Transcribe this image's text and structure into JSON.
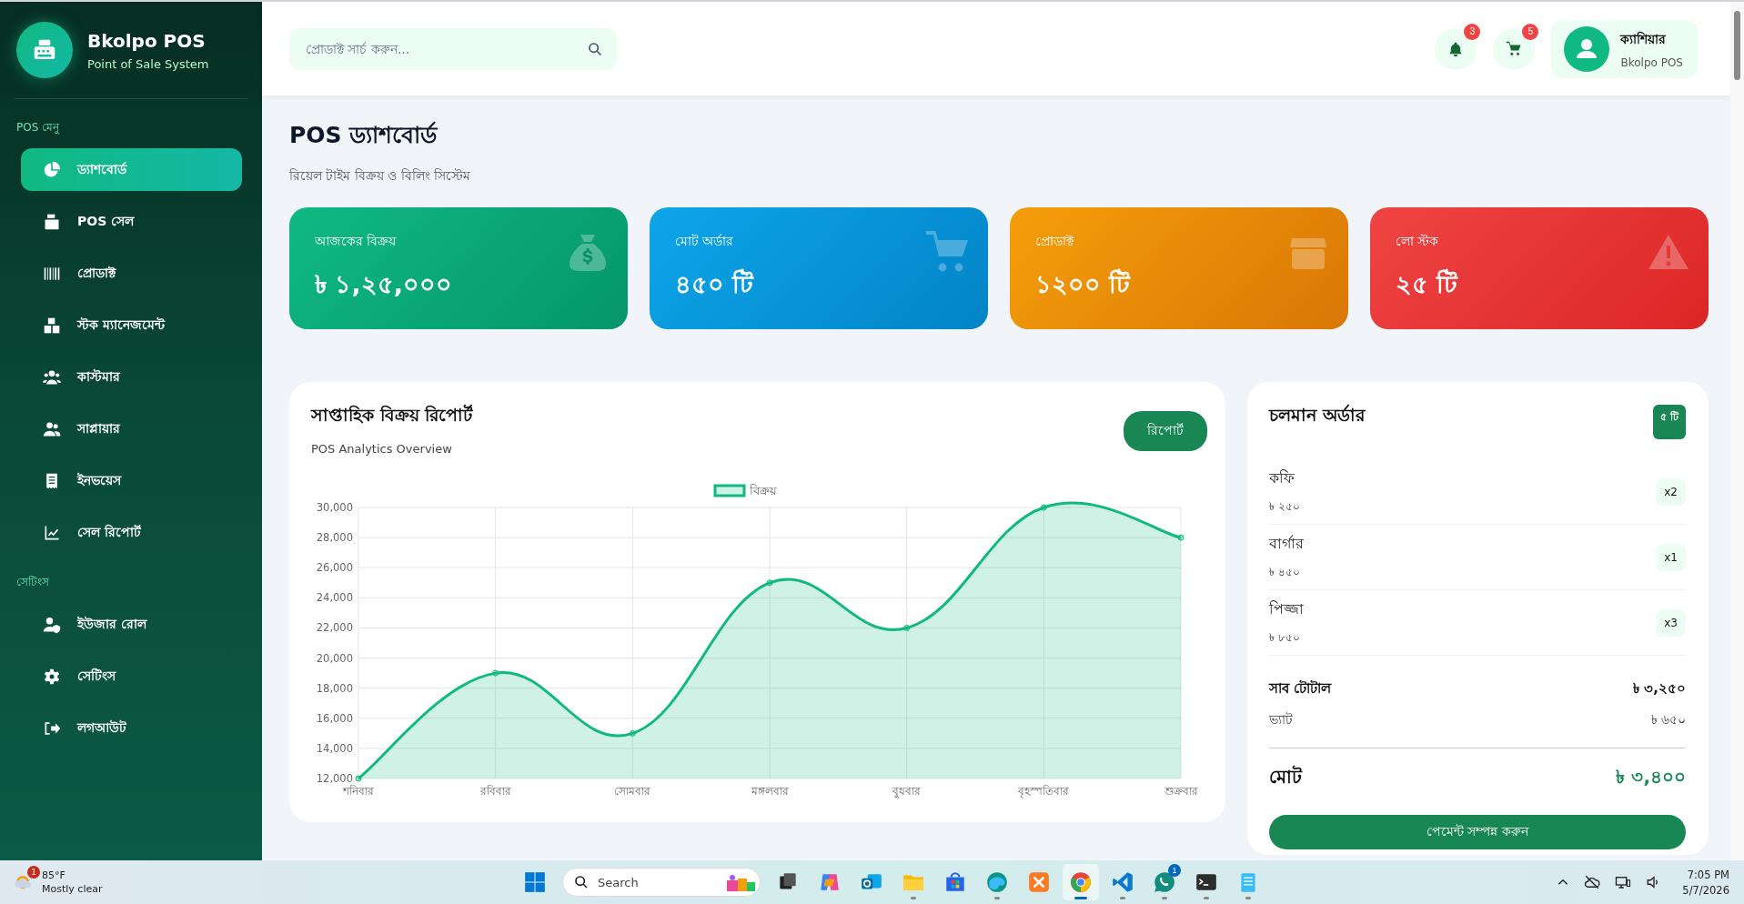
{
  "sidebar": {
    "brand": {
      "title": "Bkolpo POS",
      "subtitle": "Point of Sale System"
    },
    "sections": [
      {
        "heading": "POS মেনু",
        "items": [
          {
            "kind": "chart-pie",
            "label": "ড্যাশবোর্ড",
            "selected": true
          },
          {
            "kind": "register",
            "label": "POS সেল",
            "selected": false
          },
          {
            "kind": "barcode",
            "label": "প্রোডাক্ট",
            "selected": false
          },
          {
            "kind": "boxes",
            "label": "স্টক ম্যানেজমেন্ট",
            "selected": false
          },
          {
            "kind": "users",
            "label": "কাস্টমার",
            "selected": false
          },
          {
            "kind": "user-pair",
            "label": "সাপ্লায়ার",
            "selected": false
          },
          {
            "kind": "receipt",
            "label": "ইনভয়েস",
            "selected": false
          },
          {
            "kind": "line-chart",
            "label": "সেল রিপোর্ট",
            "selected": false
          }
        ]
      },
      {
        "heading": "সেটিংস",
        "items": [
          {
            "kind": "user-shield",
            "label": "ইউজার রোল",
            "selected": false
          },
          {
            "kind": "gear",
            "label": "সেটিংস",
            "selected": false
          },
          {
            "kind": "logout",
            "label": "লগআউট",
            "selected": false
          }
        ]
      }
    ]
  },
  "header": {
    "search": {
      "placeholder": "প্রোডাক্ট সার্চ করুন..."
    },
    "notifications": "3",
    "cart": "5",
    "user": {
      "name": "ক্যাশিয়ার",
      "role": "Bkolpo POS"
    }
  },
  "page": {
    "title": "POS ড্যাশবোর্ড",
    "subtitle": "রিয়েল টাইম বিক্রয় ও বিলিং সিস্টেম"
  },
  "stats": [
    {
      "kind": "sales",
      "label": "আজকের বিক্রয়",
      "value": "৳ ১,২৫,০০০"
    },
    {
      "kind": "orders",
      "label": "মোট অর্ডার",
      "value": "৪৫০ টি"
    },
    {
      "kind": "products",
      "label": "প্রোডাক্ট",
      "value": "১২০০ টি"
    },
    {
      "kind": "low-stock",
      "label": "লো স্টক",
      "value": "২৫ টি"
    }
  ],
  "report": {
    "title": "সাপ্তাহিক বিক্রয় রিপোর্ট",
    "subtitle": "POS Analytics Overview",
    "button": "রিপোর্ট",
    "chart_data": {
      "type": "area",
      "categories": [
        "শনিবার",
        "রবিবার",
        "সোমবার",
        "মঙ্গলবার",
        "বুধবার",
        "বৃহস্পতিবার",
        "শুক্রবার"
      ],
      "series": [
        {
          "name": "বিক্রয়",
          "color": "#10b981",
          "values": [
            12000,
            19000,
            15000,
            25000,
            22000,
            30000,
            28000
          ]
        }
      ],
      "ylim": [
        12000,
        30000
      ],
      "grid": true,
      "yticks": [
        {
          "value": 12000,
          "label": "12,000"
        },
        {
          "value": 14000,
          "label": "14,000"
        },
        {
          "value": 16000,
          "label": "16,000"
        },
        {
          "value": 18000,
          "label": "18,000"
        },
        {
          "value": 20000,
          "label": "20,000"
        },
        {
          "value": 22000,
          "label": "22,000"
        },
        {
          "value": 24000,
          "label": "24,000"
        },
        {
          "value": 26000,
          "label": "26,000"
        },
        {
          "value": 28000,
          "label": "28,000"
        },
        {
          "value": 30000,
          "label": "30,000"
        }
      ]
    }
  },
  "orders": {
    "title": "চলমান অর্ডার",
    "count": "৫ টি",
    "items": [
      {
        "name": "কফি",
        "price": "৳ ২৫০",
        "qty": "x2"
      },
      {
        "name": "বার্গার",
        "price": "৳ ৪৫০",
        "qty": "x1"
      },
      {
        "name": "পিজ্জা",
        "price": "৳ ৮৫০",
        "qty": "x3"
      }
    ],
    "subtotal": {
      "label": "সাব টোটাল",
      "value": "৳ ৩,২৫০"
    },
    "vat": {
      "label": "ভ্যাট",
      "value": "৳ ৬৫০"
    },
    "total": {
      "label": "মোট",
      "value": "৳ ৩,৪০০"
    },
    "pay_button": "পেমেন্ট সম্পন্ন করুন"
  },
  "taskbar": {
    "weather": {
      "temp": "85°F",
      "condition": "Mostly clear",
      "badge": "1"
    },
    "search": "Search",
    "apps": [
      {
        "kind": "start",
        "open": false,
        "selected": false
      },
      {
        "kind": "task-view",
        "open": false,
        "selected": false
      },
      {
        "kind": "copilot",
        "open": false,
        "selected": false
      },
      {
        "kind": "mail",
        "open": false,
        "selected": false
      },
      {
        "kind": "folder",
        "open": true,
        "selected": false
      },
      {
        "kind": "store",
        "open": false,
        "selected": false
      },
      {
        "kind": "edge",
        "open": true,
        "selected": false
      },
      {
        "kind": "xampp",
        "open": false,
        "selected": false
      },
      {
        "kind": "chrome",
        "open": true,
        "selected": true
      },
      {
        "kind": "vscode",
        "open": true,
        "selected": false
      },
      {
        "kind": "whatsapp",
        "open": true,
        "selected": false,
        "badge": "1"
      },
      {
        "kind": "terminal",
        "open": true,
        "selected": false
      },
      {
        "kind": "notepad",
        "open": true,
        "selected": false
      }
    ],
    "time": "7:05 PM",
    "date": "5/7/2026"
  }
}
